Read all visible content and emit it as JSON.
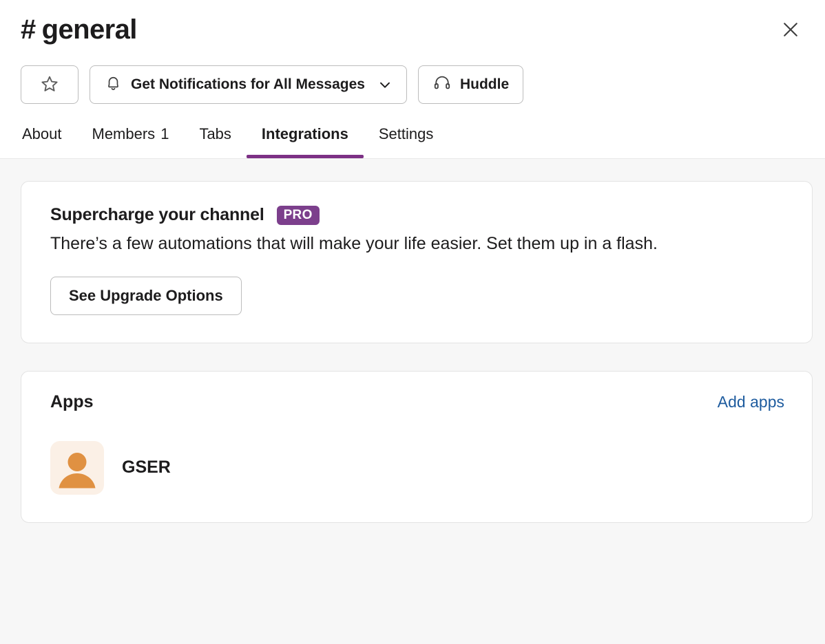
{
  "header": {
    "channel_hash": "#",
    "channel_name": "general",
    "close_icon": "close-icon",
    "star_button": {
      "icon": "star-icon",
      "label": ""
    },
    "notifications_button": {
      "icon": "bell-icon",
      "label": "Get Notifications for All Messages",
      "chevron_icon": "chevron-down-icon"
    },
    "huddle_button": {
      "icon": "headphones-icon",
      "label": "Huddle"
    }
  },
  "tabs": [
    {
      "label": "About",
      "count": "",
      "active": false
    },
    {
      "label": "Members",
      "count": "1",
      "active": false
    },
    {
      "label": "Tabs",
      "count": "",
      "active": false
    },
    {
      "label": "Integrations",
      "count": "",
      "active": true
    },
    {
      "label": "Settings",
      "count": "",
      "active": false
    }
  ],
  "upgrade_card": {
    "title": "Supercharge your channel",
    "badge": "PRO",
    "body": "There’s a few automations that will make your life easier. Set them up in a flash.",
    "button_label": "See Upgrade Options"
  },
  "apps_card": {
    "title": "Apps",
    "add_link": "Add apps",
    "apps": [
      {
        "name": "GSER",
        "avatar_icon": "person-avatar-icon"
      }
    ]
  },
  "colors": {
    "accent_purple": "#7c3085",
    "pro_badge_bg": "#7c3f8c",
    "link_blue": "#1d5b9e",
    "avatar_bg": "#fbf0e6",
    "avatar_fg": "#e09142",
    "content_bg": "#f7f7f7",
    "text_primary": "#1d1c1d",
    "border": "#e3e3e3"
  }
}
